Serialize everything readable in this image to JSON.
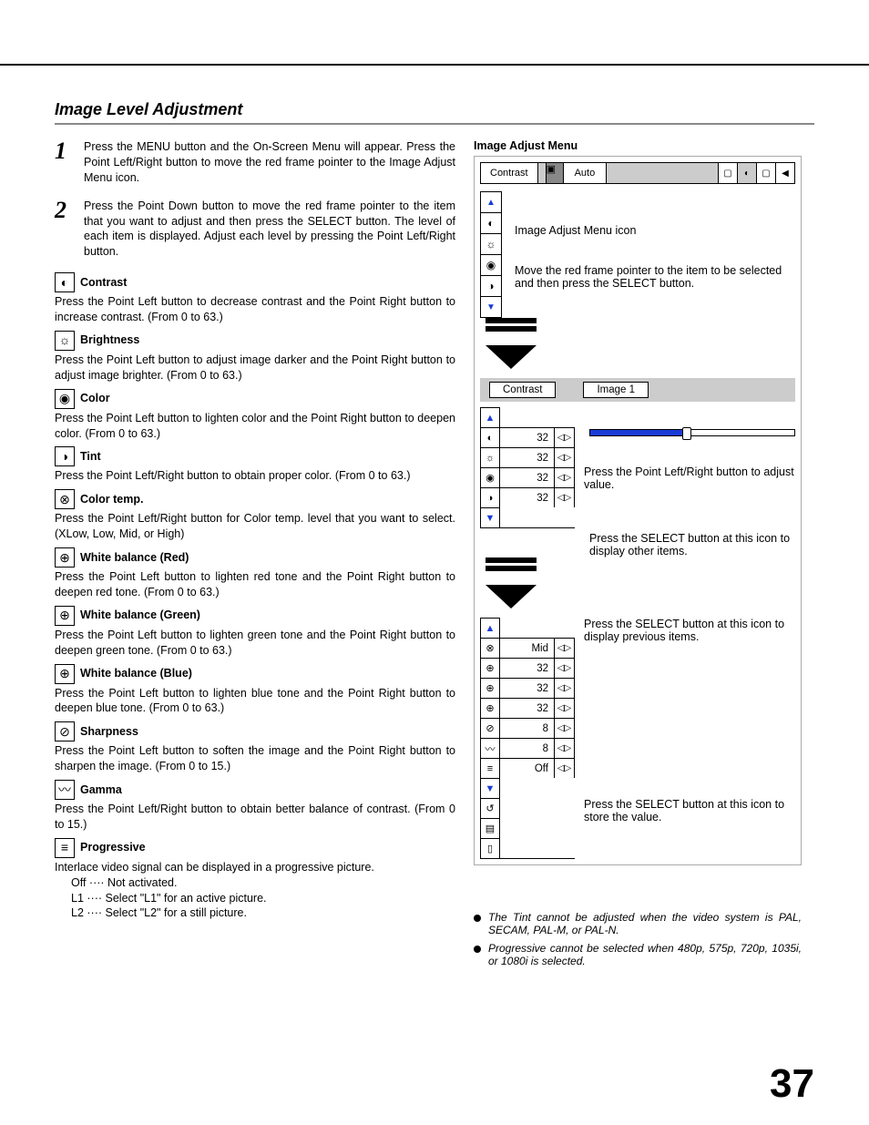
{
  "title": "Image Level Adjustment",
  "steps": [
    {
      "num": "1",
      "text": "Press the MENU button and the On-Screen Menu will appear. Press the Point Left/Right button to move the red frame pointer to the Image Adjust Menu icon."
    },
    {
      "num": "2",
      "text": "Press the Point Down button to move the red frame pointer to the item that you want to adjust and then press the SELECT button.  The level of each item is displayed.  Adjust each level by pressing the Point Left/Right button."
    }
  ],
  "adjustments": {
    "contrast": {
      "title": "Contrast",
      "desc": "Press the Point Left button to decrease contrast and the Point Right button to increase contrast.  (From 0 to 63.)"
    },
    "brightness": {
      "title": "Brightness",
      "desc": "Press the Point Left button to adjust image darker and the Point Right button to adjust image brighter.  (From 0 to 63.)"
    },
    "color": {
      "title": "Color",
      "desc": "Press the Point Left button to lighten color and the Point Right button to deepen color.  (From 0 to 63.)"
    },
    "tint": {
      "title": "Tint",
      "desc": "Press the Point Left/Right button to obtain proper color.  (From 0 to 63.)"
    },
    "colortemp": {
      "title": "Color temp.",
      "desc": "Press the Point Left/Right button for Color temp. level that you want to select. (XLow, Low, Mid, or High)"
    },
    "wbred": {
      "title": "White balance (Red)",
      "desc": "Press the Point Left button to lighten red tone and the Point Right button to deepen red tone.  (From 0 to 63.)"
    },
    "wbgreen": {
      "title": "White balance (Green)",
      "desc": "Press the Point Left button to lighten green tone and the Point Right button to deepen green tone.  (From 0 to 63.)"
    },
    "wbblue": {
      "title": "White balance (Blue)",
      "desc": "Press the Point Left button to lighten blue tone and the Point Right button to deepen blue tone.  (From 0 to 63.)"
    },
    "sharpness": {
      "title": "Sharpness",
      "desc": "Press the Point Left button to soften the image and the Point Right button to sharpen the image.  (From 0 to 15.)"
    },
    "gamma": {
      "title": "Gamma",
      "desc": "Press the Point Left/Right button to obtain better balance of contrast. (From 0 to 15.)"
    },
    "progressive": {
      "title": "Progressive",
      "desc": "Interlace video signal can be displayed in a progressive picture.",
      "options": [
        "Off ···· Not activated.",
        "L1  ···· Select \"L1\" for an active picture.",
        "L2  ···· Select \"L2\" for a still picture."
      ]
    }
  },
  "figure": {
    "title": "Image Adjust Menu",
    "menubar_label": "Contrast",
    "menubar_mode": "Auto",
    "annot_icon": "Image Adjust Menu icon",
    "annot_pointer": "Move the red frame pointer to the item to be selected and then press the SELECT button.",
    "sub_left": "Contrast",
    "sub_right": "Image 1",
    "values1": [
      "32",
      "32",
      "32",
      "32"
    ],
    "annot_lr": "Press the Point Left/Right button to adjust value.",
    "annot_other": "Press the SELECT button at this icon to display other items.",
    "annot_prev": "Press the SELECT button at this icon to display previous items.",
    "values2": [
      "Mid",
      "32",
      "32",
      "32",
      "8",
      "8",
      "Off"
    ],
    "annot_store": "Press the SELECT button at this icon to store the value."
  },
  "notes": [
    "The Tint cannot be adjusted when the video system is PAL, SECAM, PAL-M, or PAL-N.",
    "Progressive cannot be selected when 480p, 575p, 720p, 1035i, or 1080i  is selected."
  ],
  "page_number": "37"
}
